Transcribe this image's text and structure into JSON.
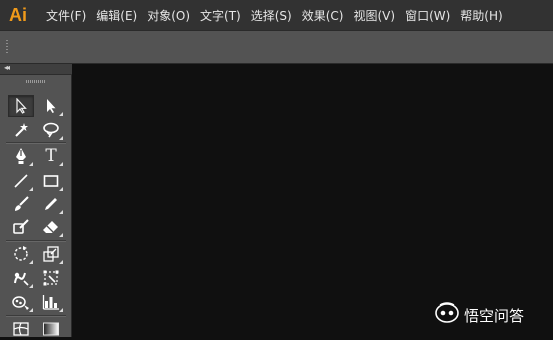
{
  "app": {
    "logo_text": "Ai"
  },
  "menu": [
    {
      "label": "文件(F)"
    },
    {
      "label": "编辑(E)"
    },
    {
      "label": "对象(O)"
    },
    {
      "label": "文字(T)"
    },
    {
      "label": "选择(S)"
    },
    {
      "label": "效果(C)"
    },
    {
      "label": "视图(V)"
    },
    {
      "label": "窗口(W)"
    },
    {
      "label": "帮助(H)"
    }
  ],
  "tools_panel": {
    "collapse_glyph": "◂◂",
    "tools": [
      {
        "name": "selection-tool-icon",
        "selected": true
      },
      {
        "name": "direct-selection-tool-icon"
      },
      {
        "name": "magic-wand-tool-icon"
      },
      {
        "name": "lasso-tool-icon"
      },
      {
        "name": "pen-tool-icon"
      },
      {
        "name": "type-tool-icon",
        "glyph": "T"
      },
      {
        "name": "line-segment-tool-icon"
      },
      {
        "name": "rectangle-tool-icon"
      },
      {
        "name": "paintbrush-tool-icon"
      },
      {
        "name": "pencil-tool-icon"
      },
      {
        "name": "blob-brush-tool-icon"
      },
      {
        "name": "eraser-tool-icon"
      },
      {
        "name": "rotate-tool-icon"
      },
      {
        "name": "scale-tool-icon"
      },
      {
        "name": "warp-tool-icon"
      },
      {
        "name": "free-transform-tool-icon"
      },
      {
        "name": "symbol-sprayer-tool-icon"
      },
      {
        "name": "column-graph-tool-icon"
      },
      {
        "name": "mesh-tool-icon"
      },
      {
        "name": "gradient-tool-icon"
      }
    ]
  },
  "watermark": {
    "text": "悟空问答"
  },
  "colors": {
    "logo": "#f09a1a",
    "menubar": "#323232",
    "panel": "#535353",
    "canvas": "#101010"
  }
}
